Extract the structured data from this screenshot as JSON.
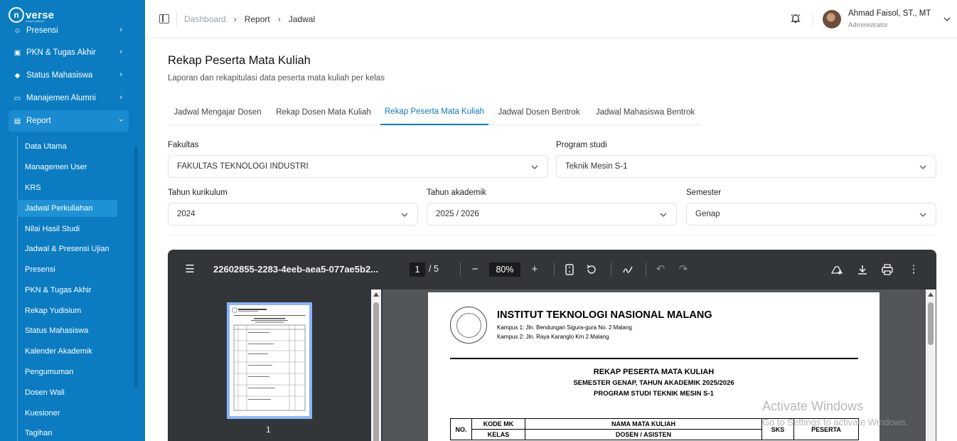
{
  "app": {
    "logo_mark": "n",
    "logo_text": "verse",
    "logo_sub": "unisys network"
  },
  "sidebar": {
    "menu": [
      {
        "label": "Presensi",
        "icon": "presensi-icon"
      },
      {
        "label": "PKN & Tugas Akhir",
        "icon": "briefcase-icon"
      },
      {
        "label": "Status Mahasiswa",
        "icon": "graduation-cap-icon"
      },
      {
        "label": "Manajemen Alumni",
        "icon": "folder-icon"
      },
      {
        "label": "Report",
        "icon": "report-icon"
      }
    ],
    "report_items": [
      "Data Utama",
      "Managemen User",
      "KRS",
      "Jadwal Perkuliahan",
      "Nilai Hasil Studi",
      "Jadwal & Presensi Ujian",
      "Presensi",
      "PKN & Tugas Akhir",
      "Rekap Yudisium",
      "Status Mahasiswa",
      "Kalender Akademik",
      "Pengumuman",
      "Dosen Wali",
      "Kuesioner",
      "Tagihan"
    ],
    "active_report_item": "Jadwal Perkuliahan",
    "colors": {
      "background": "#0b7cc1",
      "active": "#1a8bd0"
    }
  },
  "header": {
    "breadcrumb": [
      "Dashboard",
      "Report",
      "Jadwal"
    ],
    "user_name": "Ahmad Faisol, ST., MT",
    "user_role": "Administrator"
  },
  "page": {
    "title": "Rekap Peserta Mata Kuliah",
    "subtitle": "Laporan dan rekapitulasi data peserta mata kuliah per kelas"
  },
  "tabs": [
    {
      "label": "Jadwal Mengajar Dosen"
    },
    {
      "label": "Rekap Dosen Mata Kuliah"
    },
    {
      "label": "Rekap Peserta Mata Kuliah",
      "active": true
    },
    {
      "label": "Jadwal Dosen Bentrok"
    },
    {
      "label": "Jadwal Mahasiswa Bentrok"
    }
  ],
  "filters": {
    "fakultas": {
      "label": "Fakultas",
      "value": "FAKULTAS TEKNOLOGI INDUSTRI"
    },
    "program_studi": {
      "label": "Program studi",
      "value": "Teknik Mesin S-1"
    },
    "tahun_kurikulum": {
      "label": "Tahun kurikulum",
      "value": "2024"
    },
    "tahun_akademik": {
      "label": "Tahun akademik",
      "value": "2025 / 2026"
    },
    "semester": {
      "label": "Semester",
      "value": "Genap"
    }
  },
  "pdf_viewer": {
    "file_name": "22602855-2283-4eeb-aea5-077ae5b2...",
    "current_page": "1",
    "total_pages": "/ 5",
    "zoom": "80%",
    "thumbnail_page": "1",
    "document": {
      "institution": "INSTITUT TEKNOLOGI NASIONAL MALANG",
      "address_1": "Kampus 1: Jln. Bendungan Sigura-gura No. 2 Malang",
      "address_2": "Kampus 2: Jln. Raya Karanglo Km 2 Malang",
      "title": "REKAP PESERTA MATA KULIAH",
      "subtitle_1": "SEMESTER GENAP, TAHUN AKADEMIK 2025/2026",
      "subtitle_2": "PROGRAM STUDI TEKNIK MESIN S-1",
      "table_headers": {
        "no": "NO.",
        "kode_mk": "KODE MK",
        "kelas": "KELAS",
        "nama_mk": "NAMA MATA KULIAH",
        "dosen": "DOSEN / ASISTEN",
        "sks": "SKS",
        "peserta": "PESERTA"
      }
    }
  },
  "watermark": {
    "line1": "Activate Windows",
    "line2": "Go to Settings to activate Windows."
  }
}
